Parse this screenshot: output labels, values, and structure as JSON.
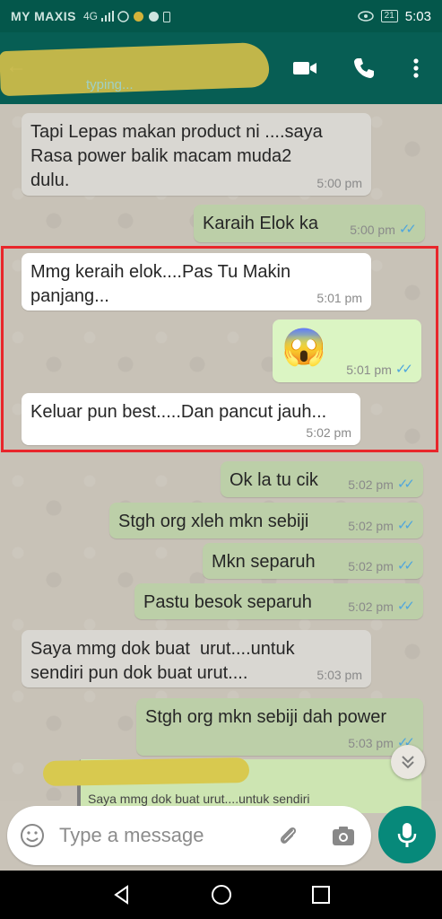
{
  "status_bar": {
    "carrier": "MY MAXIS",
    "network": "4G",
    "battery": "21",
    "time": "5:03"
  },
  "header": {
    "contact_subtitle": "typing..."
  },
  "messages": [
    {
      "dir": "in",
      "text": "Tapi Lepas makan product ni ....saya\nRasa power balik macam muda2\ndulu.",
      "time": "5:00 pm"
    },
    {
      "dir": "out",
      "text": "Karaih Elok ka",
      "time": "5:00 pm"
    },
    {
      "dir": "in",
      "text": "Mmg keraih elok....Pas Tu Makin\npanjang...",
      "time": "5:01 pm"
    },
    {
      "dir": "out",
      "text": "😱",
      "time": "5:01 pm"
    },
    {
      "dir": "in",
      "text": "Keluar pun best.....Dan pancut jauh...",
      "time": "5:02 pm"
    },
    {
      "dir": "out",
      "text": "Ok la tu cik",
      "time": "5:02 pm"
    },
    {
      "dir": "out",
      "text": "Stgh org xleh mkn sebiji",
      "time": "5:02 pm"
    },
    {
      "dir": "out",
      "text": "Mkn separuh",
      "time": "5:02 pm"
    },
    {
      "dir": "out",
      "text": "Pastu besok separuh",
      "time": "5:02 pm"
    },
    {
      "dir": "in",
      "text": "Saya mmg dok buat  urut....untuk\nsendiri pun dok buat urut....",
      "time": "5:03 pm"
    },
    {
      "dir": "out",
      "text": "Stgh org mkn sebiji dah power",
      "time": "5:03 pm"
    }
  ],
  "reply_preview": {
    "text": "Saya mmg dok buat  urut....untuk sendiri"
  },
  "composer": {
    "placeholder": "Type a message"
  },
  "colors": {
    "header": "#075e54",
    "outgoing_bubble": "#dcf8c6",
    "incoming_bubble": "#ffffff",
    "highlight_border": "#e8262b",
    "mic_button": "#07897a",
    "read_ticks": "#4fa6dd"
  },
  "icons": [
    "back-arrow-icon",
    "video-call-icon",
    "phone-call-icon",
    "more-options-icon",
    "emoji-icon",
    "attach-icon",
    "camera-icon",
    "mic-icon",
    "scroll-down-icon",
    "nav-back-icon",
    "nav-home-icon",
    "nav-recents-icon"
  ]
}
